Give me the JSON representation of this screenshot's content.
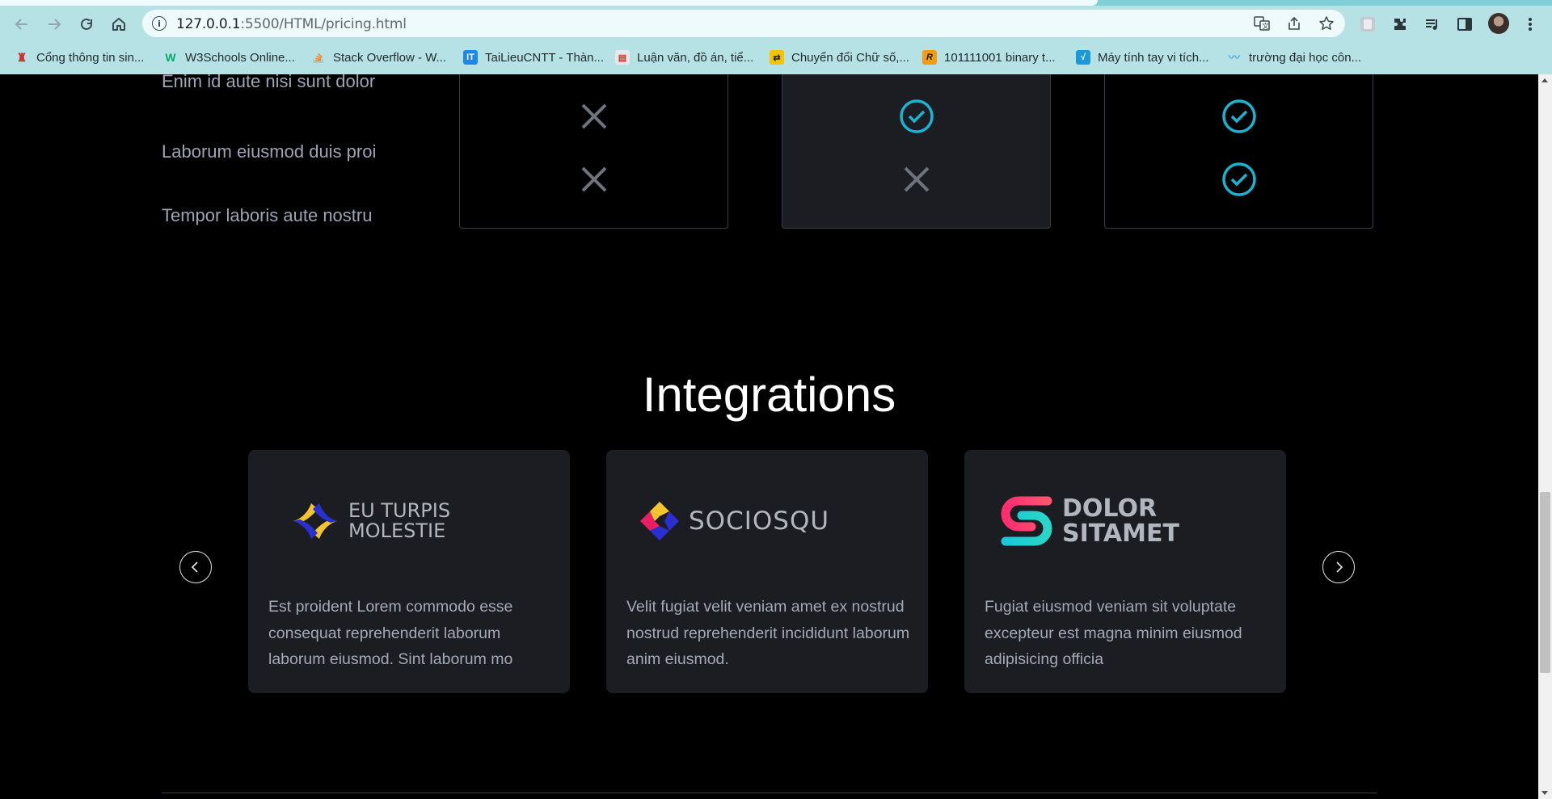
{
  "browser": {
    "url_host": "127.0.0.1",
    "url_rest": ":5500/HTML/pricing.html",
    "bookmarks": [
      {
        "label": "Cổng thông tin sin...",
        "icon": "university-logo-icon",
        "color": "#c9302c"
      },
      {
        "label": "W3Schools Online...",
        "icon": "w3schools-icon",
        "color": "#04aa6d"
      },
      {
        "label": "Stack Overflow - W...",
        "icon": "stackoverflow-icon",
        "color": "#f48024"
      },
      {
        "label": "TaiLieuCNTT - Thàn...",
        "icon": "tailieucntt-icon",
        "color": "#1e88e5"
      },
      {
        "label": "Luận văn, đồ án, tiể...",
        "icon": "luanvan-icon",
        "color": "#e0e0e0"
      },
      {
        "label": "Chuyển đổi Chữ số,...",
        "icon": "converter-icon",
        "color": "#f5c400"
      },
      {
        "label": "101111001 binary t...",
        "icon": "rapidtables-icon",
        "color": "#f39c12"
      },
      {
        "label": "Máy tính tay vi tích...",
        "icon": "calculator-icon",
        "color": "#1a9bd7"
      },
      {
        "label": "trường đại học côn...",
        "icon": "school-icon",
        "color": "#5aa9e6"
      }
    ]
  },
  "comparison": {
    "features": [
      {
        "label": "Enim id aute nisi sunt dolor",
        "marks": [
          "none",
          "none",
          "none"
        ]
      },
      {
        "label": "Laborum eiusmod duis proi",
        "marks": [
          "cross",
          "check",
          "check"
        ]
      },
      {
        "label": "Tempor laboris aute nostru",
        "marks": [
          "cross",
          "cross",
          "check"
        ]
      }
    ],
    "check_color": "#1ab4d2",
    "cross_color": "#6f737d"
  },
  "integrations": {
    "title": "Integrations",
    "cards": [
      {
        "logo_line1": "EU TURPIS",
        "logo_line2": "MOLESTIE",
        "description": "Est proident Lorem commodo esse consequat reprehenderit laborum laborum eiusmod. Sint laborum mo"
      },
      {
        "logo_line1": "SOCIOSQU",
        "logo_line2": "",
        "description": "Velit fugiat velit veniam amet ex nostrud nostrud reprehenderit incididunt laborum anim eiusmod."
      },
      {
        "logo_line1": "DOLOR",
        "logo_line2": "SITAMET",
        "description": "Fugiat eiusmod veniam sit voluptate excepteur est magna minim eiusmod adipisicing officia"
      }
    ]
  }
}
